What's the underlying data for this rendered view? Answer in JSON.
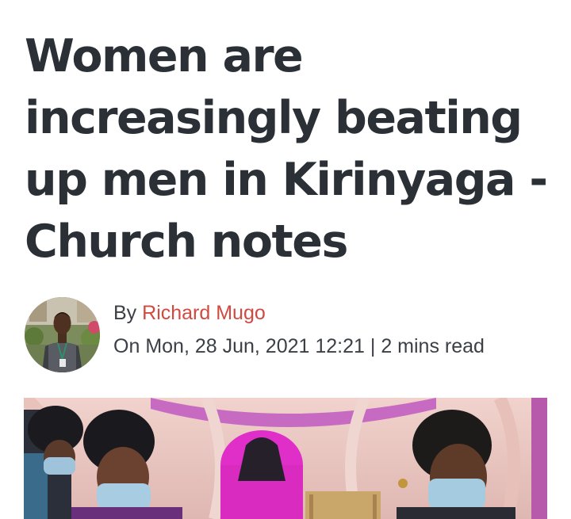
{
  "article": {
    "title": "Women are increasingly beating up men in Kirinyaga -Church notes",
    "by_prefix": "By",
    "author": "Richard Mugo",
    "date_prefix": "On",
    "date": "Mon, 28 Jun, 2021 12:21",
    "separator": "|",
    "read_time": "2 mins read"
  },
  "colors": {
    "title": "#2b3036",
    "author_link": "#d2493f",
    "meta_text": "#3b4046"
  }
}
